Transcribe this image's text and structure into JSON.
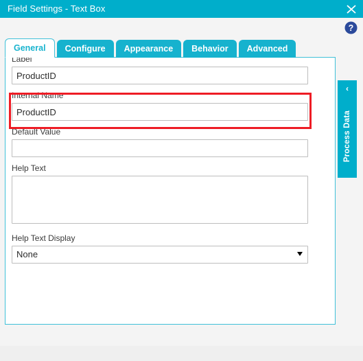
{
  "window": {
    "title": "Field Settings - Text Box",
    "close_icon": "close-icon",
    "help_icon": "help-circle-icon"
  },
  "tabs": [
    {
      "label": "General",
      "active": true
    },
    {
      "label": "Configure",
      "active": false
    },
    {
      "label": "Appearance",
      "active": false
    },
    {
      "label": "Behavior",
      "active": false
    },
    {
      "label": "Advanced",
      "active": false
    }
  ],
  "form": {
    "label_field": {
      "label": "Label",
      "value": "ProductID",
      "placeholder": ""
    },
    "internal_name_field": {
      "label": "Internal Name",
      "value": "ProductID",
      "placeholder": ""
    },
    "default_value_field": {
      "label": "Default Value",
      "value": "",
      "placeholder": ""
    },
    "help_text_field": {
      "label": "Help Text",
      "value": "",
      "placeholder": ""
    },
    "help_text_display_field": {
      "label": "Help Text Display",
      "value": "None",
      "options": [
        "None"
      ],
      "arrow_icon": "chevron-down-icon"
    }
  },
  "side_panel": {
    "label": "Process Data",
    "collapse_icon": "chevron-left-icon",
    "chevron_glyph": "‹"
  },
  "colors": {
    "brand_cyan": "#00aecb",
    "tab_cyan": "#16b2ce",
    "tab_border": "#3fc0d8",
    "highlight_red": "#ee1c25",
    "help_blue": "#2b4a9b"
  }
}
